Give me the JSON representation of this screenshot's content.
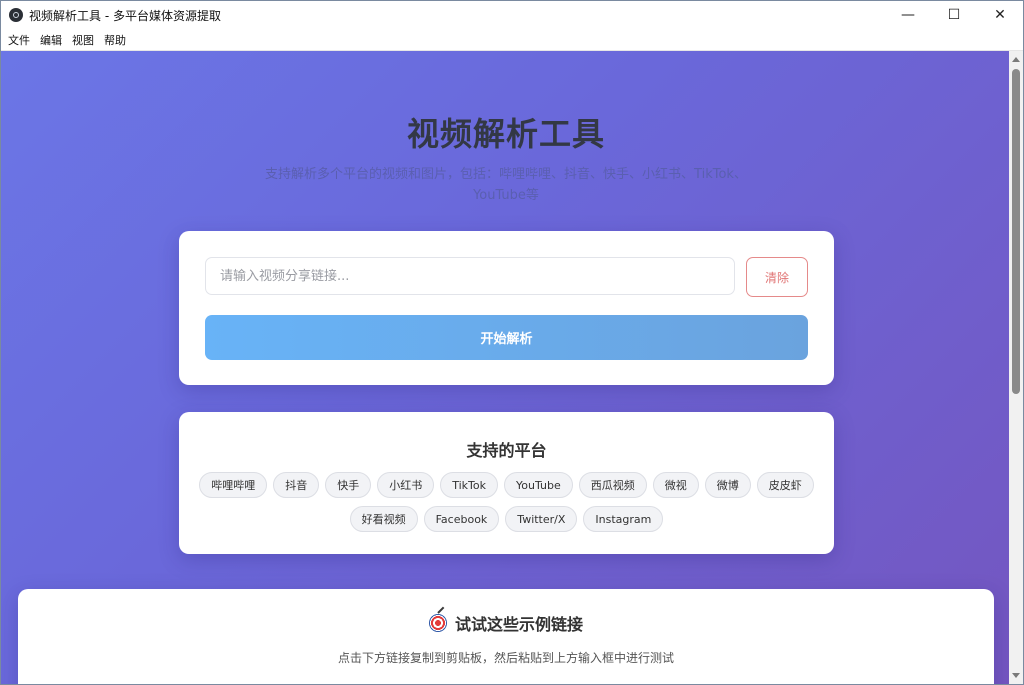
{
  "window": {
    "title": "视频解析工具 - 多平台媒体资源提取",
    "controls": {
      "minimize": "—",
      "maximize": "☐",
      "close": "✕"
    }
  },
  "menu": [
    "文件",
    "编辑",
    "视图",
    "帮助"
  ],
  "hero": {
    "title": "视频解析工具",
    "subtitle": "支持解析多个平台的视频和图片，包括：哔哩哔哩、抖音、快手、小红书、TikTok、YouTube等"
  },
  "input_card": {
    "placeholder": "请输入视频分享链接...",
    "value": "",
    "clear_label": "清除",
    "parse_label": "开始解析"
  },
  "platforms": {
    "title": "支持的平台",
    "row1": [
      "哔哩哔哩",
      "抖音",
      "快手",
      "小红书",
      "TikTok",
      "YouTube",
      "西瓜视频",
      "微视",
      "微博",
      "皮皮虾"
    ],
    "row2": [
      "好看视频",
      "Facebook",
      "Twitter/X",
      "Instagram"
    ]
  },
  "examples": {
    "icon": "target-icon",
    "title": "试试这些示例链接",
    "subtitle": "点击下方链接复制到剪贴板，然后粘贴到上方输入框中进行测试"
  },
  "colors": {
    "gradient_start": "#6b76e6",
    "gradient_end": "#7456c0",
    "parse_button": "#68b3f7",
    "clear_button": "#e07474"
  }
}
